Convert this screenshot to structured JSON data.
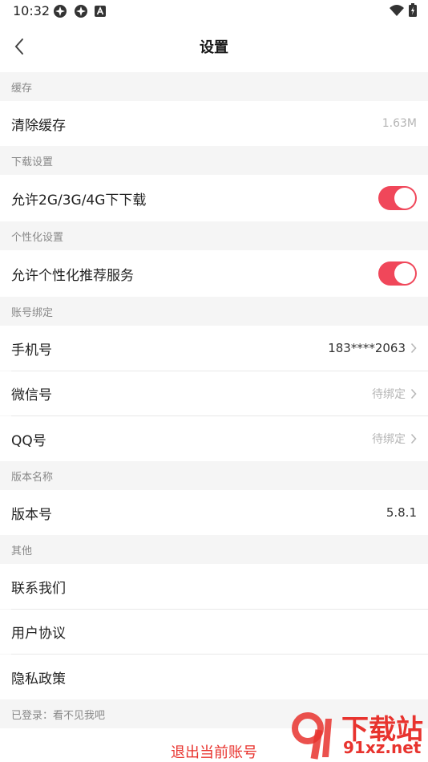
{
  "status_bar": {
    "time": "10:32"
  },
  "header": {
    "title": "设置"
  },
  "sections": {
    "cache": {
      "title": "缓存",
      "clear_label": "清除缓存",
      "clear_value": "1.63M"
    },
    "download": {
      "title": "下载设置",
      "allow_label": "允许2G/3G/4G下下载",
      "allow_on": true
    },
    "personal": {
      "title": "个性化设置",
      "recommend_label": "允许个性化推荐服务",
      "recommend_on": true
    },
    "account": {
      "title": "账号绑定",
      "phone_label": "手机号",
      "phone_value": "183****2063",
      "wechat_label": "微信号",
      "wechat_value": "待绑定",
      "qq_label": "QQ号",
      "qq_value": "待绑定"
    },
    "version": {
      "title": "版本名称",
      "version_label": "版本号",
      "version_value": "5.8.1"
    },
    "other": {
      "title": "其他",
      "contact_label": "联系我们",
      "agreement_label": "用户协议",
      "privacy_label": "隐私政策"
    }
  },
  "login_status": "已登录：看不见我吧",
  "logout_label": "退出当前账号",
  "watermark": {
    "text_cn": "下载站",
    "text_en": "91xz.net",
    "color": "#e8332e"
  },
  "colors": {
    "toggle_on": "#f0475a",
    "logout": "#e8332e"
  }
}
